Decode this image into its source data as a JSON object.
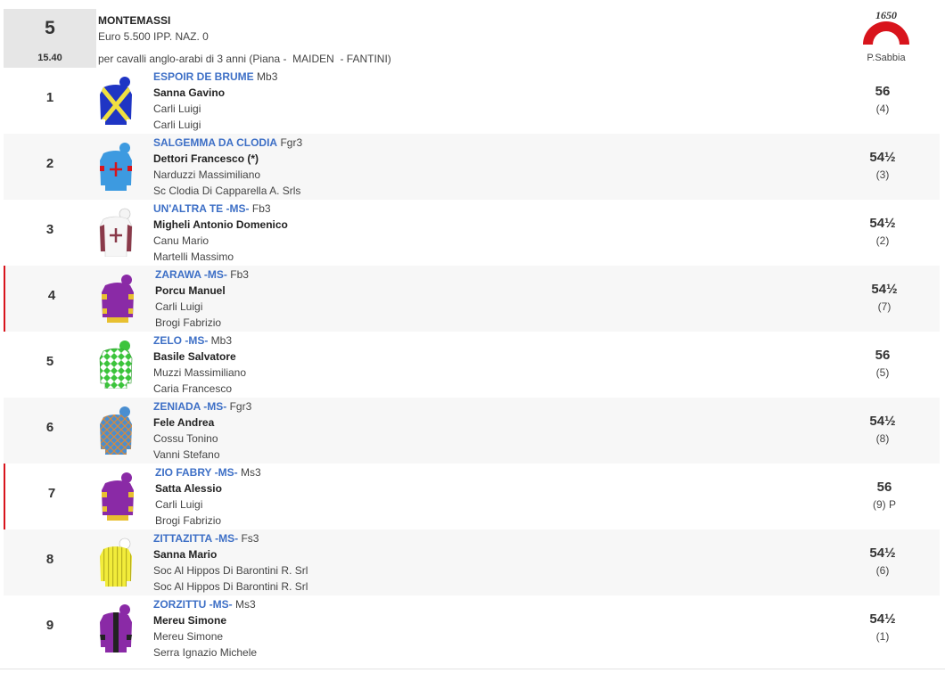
{
  "race": {
    "number": "5",
    "time": "15.40",
    "name": "MONTEMASSI",
    "prize": "Euro 5.500 IPP. NAZ. 0",
    "conditions": "per cavalli anglo-arabi di 3 anni (Piana -  MAIDEN  - FANTINI)",
    "track_logo_text": "1650",
    "track": "P.Sabbia"
  },
  "colors": {
    "horse_link": "#3d6fc6",
    "track_logo": "#d8141c",
    "flag": "#d8141c"
  },
  "runners": [
    {
      "num": "1",
      "horse": "ESPOIR DE BRUME",
      "meta": "Mb3",
      "jockey": "Sanna Gavino",
      "trainer": "Carli Luigi",
      "owner": "Carli Luigi",
      "weight": "56",
      "draw": "(4)",
      "silk_icon": "silk-blue-yellow-cross-icon"
    },
    {
      "num": "2",
      "horse": "SALGEMMA DA CLODIA",
      "meta": "Fgr3",
      "jockey": "Dettori Francesco (*)",
      "trainer": "Narduzzi Massimiliano",
      "owner": "Sc Clodia Di Capparella A. Srls",
      "weight": "54½",
      "draw": "(3)",
      "silk_icon": "silk-lightblue-red-cross-icon"
    },
    {
      "num": "3",
      "horse": "UN'ALTRA TE -MS-",
      "meta": "Fb3",
      "jockey": "Migheli Antonio Domenico",
      "trainer": "Canu Mario",
      "owner": "Martelli Massimo",
      "weight": "54½",
      "draw": "(2)",
      "silk_icon": "silk-white-maroon-cross-icon"
    },
    {
      "num": "4",
      "horse": "ZARAWA -MS-",
      "meta": "Fb3",
      "jockey": "Porcu Manuel",
      "trainer": "Carli Luigi",
      "owner": "Brogi Fabrizio",
      "weight": "54½",
      "draw": "(7)",
      "silk_icon": "silk-purple-yellow-hoops-icon"
    },
    {
      "num": "5",
      "horse": "ZELO -MS-",
      "meta": "Mb3",
      "jockey": "Basile Salvatore",
      "trainer": "Muzzi Massimiliano",
      "owner": "Caria Francesco",
      "weight": "56",
      "draw": "(5)",
      "silk_icon": "silk-green-white-diamonds-icon"
    },
    {
      "num": "6",
      "horse": "ZENIADA -MS-",
      "meta": "Fgr3",
      "jockey": "Fele Andrea",
      "trainer": "Cossu Tonino",
      "owner": "Vanni Stefano",
      "weight": "54½",
      "draw": "(8)",
      "silk_icon": "silk-blue-checks-icon"
    },
    {
      "num": "7",
      "horse": "ZIO FABRY -MS-",
      "meta": "Ms3",
      "jockey": "Satta Alessio",
      "trainer": "Carli Luigi",
      "owner": "Brogi Fabrizio",
      "weight": "56",
      "draw": "(9) P",
      "silk_icon": "silk-purple-yellow-hoops-icon"
    },
    {
      "num": "8",
      "horse": "ZITTAZITTA -MS-",
      "meta": "Fs3",
      "jockey": "Sanna Mario",
      "trainer": "Soc Al Hippos Di Barontini R. Srl",
      "owner": "Soc Al Hippos Di Barontini R. Srl",
      "weight": "54½",
      "draw": "(6)",
      "silk_icon": "silk-yellow-stripes-icon"
    },
    {
      "num": "9",
      "horse": "ZORZITTU -MS-",
      "meta": "Ms3",
      "jockey": "Mereu Simone",
      "trainer": "Mereu Simone",
      "owner": "Serra Ignazio Michele",
      "weight": "54½",
      "draw": "(1)",
      "silk_icon": "silk-purple-black-stripe-icon"
    }
  ]
}
